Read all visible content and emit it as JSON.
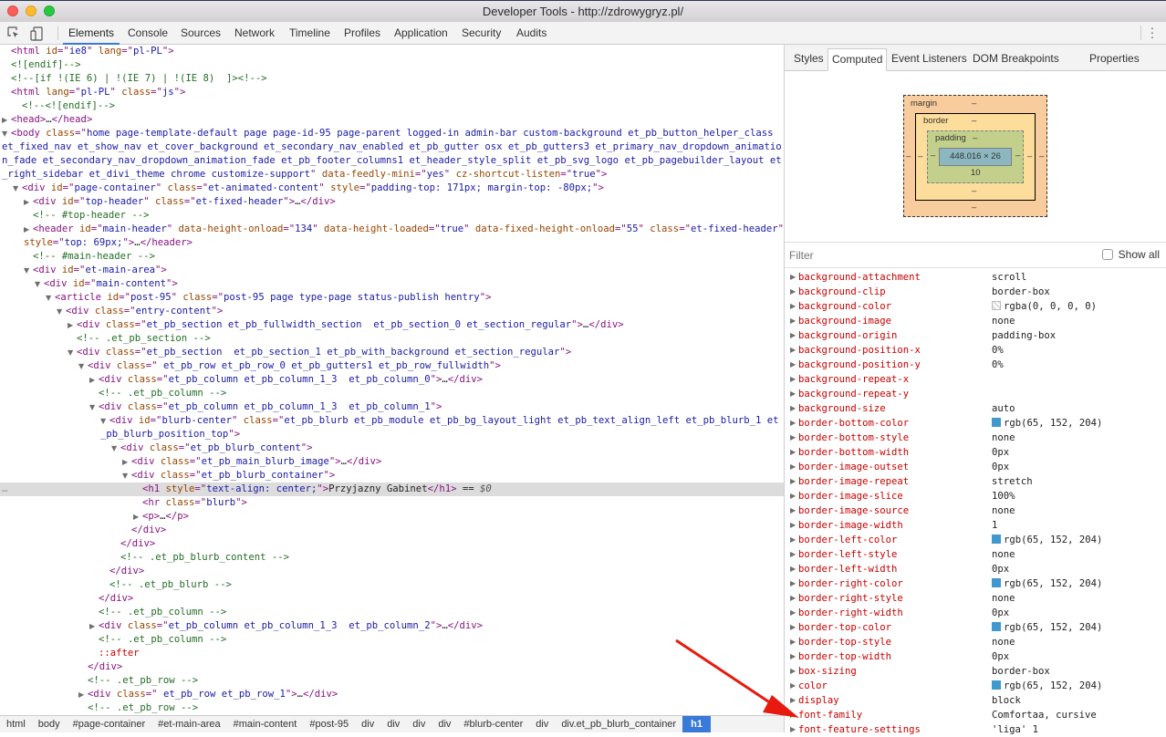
{
  "window": {
    "title": "Developer Tools - http://zdrowygryz.pl/"
  },
  "toolbar": {
    "inspect_icon": "inspect-element-icon",
    "device_icon": "device-toolbar-icon",
    "more_icon": "more-vertical-icon",
    "tabs": [
      {
        "label": "Elements",
        "active": true
      },
      {
        "label": "Console",
        "active": false
      },
      {
        "label": "Sources",
        "active": false
      },
      {
        "label": "Network",
        "active": false
      },
      {
        "label": "Timeline",
        "active": false
      },
      {
        "label": "Profiles",
        "active": false
      },
      {
        "label": "Application",
        "active": false
      },
      {
        "label": "Security",
        "active": false
      },
      {
        "label": "Audits",
        "active": false
      }
    ]
  },
  "elements": {
    "lines": [
      {
        "indent": 0,
        "tri": "",
        "html": "<span class=\"tag\">&lt;html</span> <span class=\"attr-n\">id</span><span class=\"tag\">=\"</span><span class=\"attr-v\">ie8</span><span class=\"tag\">\"</span> <span class=\"attr-n\">lang</span><span class=\"tag\">=\"</span><span class=\"attr-v\">pl-PL</span><span class=\"tag\">\"&gt;</span>"
      },
      {
        "indent": 0,
        "tri": "",
        "html": "<span class=\"comment\">&lt;![endif]--&gt;</span>"
      },
      {
        "indent": 0,
        "tri": "",
        "html": "<span class=\"comment\">&lt;!--[if !(IE 6) | !(IE 7) | !(IE 8)  ]&gt;&lt;!--&gt;</span>"
      },
      {
        "indent": 0,
        "tri": "",
        "html": "<span class=\"tag\">&lt;html</span> <span class=\"attr-n\">lang</span><span class=\"tag\">=\"</span><span class=\"attr-v\">pl-PL</span><span class=\"tag\">\"</span> <span class=\"attr-n\">class</span><span class=\"tag\">=\"</span><span class=\"attr-v\">js</span><span class=\"tag\">\"&gt;</span>"
      },
      {
        "indent": 1,
        "tri": "",
        "html": "<span class=\"comment\">&lt;!--&lt;![endif]--&gt;</span>"
      },
      {
        "indent": 0,
        "tri": "closed",
        "html": "<span class=\"tag\">&lt;head&gt;</span>…<span class=\"tag\">&lt;/head&gt;</span>"
      },
      {
        "indent": 0,
        "tri": "open",
        "wrap": true,
        "html": "<span class=\"tag\">&lt;body</span> <span class=\"attr-n\">class</span><span class=\"tag\">=\"</span><span class=\"attr-v\">home page-template-default page page-id-95 page-parent logged-in admin-bar custom-background et_pb_button_helper_class et_fixed_nav et_show_nav et_cover_background et_secondary_nav_enabled et_pb_gutter osx et_pb_gutters3 et_primary_nav_dropdown_animation_fade et_secondary_nav_dropdown_animation_fade et_pb_footer_columns1 et_header_style_split et_pb_svg_logo et_pb_pagebuilder_layout et_right_sidebar et_divi_theme chrome customize-support</span><span class=\"tag\">\"</span> <span class=\"attr-n\">data-feedly-mini</span><span class=\"tag\">=\"</span><span class=\"attr-v\">yes</span><span class=\"tag\">\"</span> <span class=\"attr-n\">cz-shortcut-listen</span><span class=\"tag\">=\"</span><span class=\"attr-v\">true</span><span class=\"tag\">\"&gt;</span>"
      },
      {
        "indent": 1,
        "tri": "open",
        "html": "<span class=\"tag\">&lt;div</span> <span class=\"attr-n\">id</span><span class=\"tag\">=\"</span><span class=\"attr-v\">page-container</span><span class=\"tag\">\"</span> <span class=\"attr-n\">class</span><span class=\"tag\">=\"</span><span class=\"attr-v\">et-animated-content</span><span class=\"tag\">\"</span> <span class=\"attr-n\">style</span><span class=\"tag\">=\"</span><span class=\"attr-v\">padding-top: 171px; margin-top: -80px;</span><span class=\"tag\">\"&gt;</span>"
      },
      {
        "indent": 2,
        "tri": "closed",
        "html": "<span class=\"tag\">&lt;div</span> <span class=\"attr-n\">id</span><span class=\"tag\">=\"</span><span class=\"attr-v\">top-header</span><span class=\"tag\">\"</span> <span class=\"attr-n\">class</span><span class=\"tag\">=\"</span><span class=\"attr-v\">et-fixed-header</span><span class=\"tag\">\"&gt;</span>…<span class=\"tag\">&lt;/div&gt;</span>"
      },
      {
        "indent": 2,
        "tri": "",
        "html": "<span class=\"comment\">&lt;!-- #top-header --&gt;</span>"
      },
      {
        "indent": 2,
        "tri": "closed",
        "wrap": true,
        "html": "<span class=\"tag\">&lt;header</span> <span class=\"attr-n\">id</span><span class=\"tag\">=\"</span><span class=\"attr-v\">main-header</span><span class=\"tag\">\"</span> <span class=\"attr-n\">data-height-onload</span><span class=\"tag\">=\"</span><span class=\"attr-v\">134</span><span class=\"tag\">\"</span> <span class=\"attr-n\">data-height-loaded</span><span class=\"tag\">=\"</span><span class=\"attr-v\">true</span><span class=\"tag\">\"</span> <span class=\"attr-n\">data-fixed-height-onload</span><span class=\"tag\">=\"</span><span class=\"attr-v\">55</span><span class=\"tag\">\"</span> <span class=\"attr-n\">class</span><span class=\"tag\">=\"</span><span class=\"attr-v\">et-fixed-header</span><span class=\"tag\">\"</span> <span class=\"attr-n\">style</span><span class=\"tag\">=\"</span><span class=\"attr-v\">top: 69px;</span><span class=\"tag\">\"&gt;</span>…<span class=\"tag\">&lt;/header&gt;</span>"
      },
      {
        "indent": 2,
        "tri": "",
        "html": "<span class=\"comment\">&lt;!-- #main-header --&gt;</span>"
      },
      {
        "indent": 2,
        "tri": "open",
        "html": "<span class=\"tag\">&lt;div</span> <span class=\"attr-n\">id</span><span class=\"tag\">=\"</span><span class=\"attr-v\">et-main-area</span><span class=\"tag\">\"&gt;</span>"
      },
      {
        "indent": 3,
        "tri": "open",
        "html": "<span class=\"tag\">&lt;div</span> <span class=\"attr-n\">id</span><span class=\"tag\">=\"</span><span class=\"attr-v\">main-content</span><span class=\"tag\">\"&gt;</span>"
      },
      {
        "indent": 4,
        "tri": "open",
        "html": "<span class=\"tag\">&lt;article</span> <span class=\"attr-n\">id</span><span class=\"tag\">=\"</span><span class=\"attr-v\">post-95</span><span class=\"tag\">\"</span> <span class=\"attr-n\">class</span><span class=\"tag\">=\"</span><span class=\"attr-v\">post-95 page type-page status-publish hentry</span><span class=\"tag\">\"&gt;</span>"
      },
      {
        "indent": 5,
        "tri": "open",
        "html": "<span class=\"tag\">&lt;div</span> <span class=\"attr-n\">class</span><span class=\"tag\">=\"</span><span class=\"attr-v\">entry-content</span><span class=\"tag\">\"&gt;</span>"
      },
      {
        "indent": 6,
        "tri": "closed",
        "html": "<span class=\"tag\">&lt;div</span> <span class=\"attr-n\">class</span><span class=\"tag\">=\"</span><span class=\"attr-v\">et_pb_section et_pb_fullwidth_section  et_pb_section_0 et_section_regular</span><span class=\"tag\">\"&gt;</span>…<span class=\"tag\">&lt;/div&gt;</span>"
      },
      {
        "indent": 6,
        "tri": "",
        "html": "<span class=\"comment\">&lt;!-- .et_pb_section --&gt;</span>"
      },
      {
        "indent": 6,
        "tri": "open",
        "html": "<span class=\"tag\">&lt;div</span> <span class=\"attr-n\">class</span><span class=\"tag\">=\"</span><span class=\"attr-v\">et_pb_section  et_pb_section_1 et_pb_with_background et_section_regular</span><span class=\"tag\">\"&gt;</span>"
      },
      {
        "indent": 7,
        "tri": "open",
        "html": "<span class=\"tag\">&lt;div</span> <span class=\"attr-n\">class</span><span class=\"tag\">=\"</span><span class=\"attr-v\"> et_pb_row et_pb_row_0 et_pb_gutters1 et_pb_row_fullwidth</span><span class=\"tag\">\"&gt;</span>"
      },
      {
        "indent": 8,
        "tri": "closed",
        "html": "<span class=\"tag\">&lt;div</span> <span class=\"attr-n\">class</span><span class=\"tag\">=\"</span><span class=\"attr-v\">et_pb_column et_pb_column_1_3  et_pb_column_0</span><span class=\"tag\">\"&gt;</span>…<span class=\"tag\">&lt;/div&gt;</span>"
      },
      {
        "indent": 8,
        "tri": "",
        "html": "<span class=\"comment\">&lt;!-- .et_pb_column --&gt;</span>"
      },
      {
        "indent": 8,
        "tri": "open",
        "html": "<span class=\"tag\">&lt;div</span> <span class=\"attr-n\">class</span><span class=\"tag\">=\"</span><span class=\"attr-v\">et_pb_column et_pb_column_1_3  et_pb_column_1</span><span class=\"tag\">\"&gt;</span>"
      },
      {
        "indent": 9,
        "tri": "open",
        "wrap": true,
        "html": "<span class=\"tag\">&lt;div</span> <span class=\"attr-n\">id</span><span class=\"tag\">=\"</span><span class=\"attr-v\">blurb-center</span><span class=\"tag\">\"</span> <span class=\"attr-n\">class</span><span class=\"tag\">=\"</span><span class=\"attr-v\">et_pb_blurb et_pb_module et_pb_bg_layout_light et_pb_text_align_left et_pb_blurb_1 et_pb_blurb_position_top</span><span class=\"tag\">\"&gt;</span>"
      },
      {
        "indent": 10,
        "tri": "open",
        "html": "<span class=\"tag\">&lt;div</span> <span class=\"attr-n\">class</span><span class=\"tag\">=\"</span><span class=\"attr-v\">et_pb_blurb_content</span><span class=\"tag\">\"&gt;</span>"
      },
      {
        "indent": 11,
        "tri": "closed",
        "html": "<span class=\"tag\">&lt;div</span> <span class=\"attr-n\">class</span><span class=\"tag\">=\"</span><span class=\"attr-v\">et_pb_main_blurb_image</span><span class=\"tag\">\"&gt;</span>…<span class=\"tag\">&lt;/div&gt;</span>"
      },
      {
        "indent": 11,
        "tri": "open",
        "html": "<span class=\"tag\">&lt;div</span> <span class=\"attr-n\">class</span><span class=\"tag\">=\"</span><span class=\"attr-v\">et_pb_blurb_container</span><span class=\"tag\">\"&gt;</span>"
      },
      {
        "indent": 12,
        "tri": "",
        "selected": true,
        "html": "<span class=\"tag\">&lt;h1</span> <span class=\"attr-n\">style</span><span class=\"tag\">=\"</span><span class=\"attr-v\">text-align: center;</span><span class=\"tag\">\"&gt;</span>Przyjazny Gabinet<span class=\"tag\">&lt;/h1&gt;</span> == <span class=\"dollar\">$0</span>"
      },
      {
        "indent": 12,
        "tri": "",
        "html": "<span class=\"tag\">&lt;hr</span> <span class=\"attr-n\">class</span><span class=\"tag\">=\"</span><span class=\"attr-v\">blurb</span><span class=\"tag\">\"&gt;</span>"
      },
      {
        "indent": 12,
        "tri": "closed",
        "html": "<span class=\"tag\">&lt;p&gt;</span>…<span class=\"tag\">&lt;/p&gt;</span>"
      },
      {
        "indent": 11,
        "tri": "",
        "html": "<span class=\"tag\">&lt;/div&gt;</span>"
      },
      {
        "indent": 10,
        "tri": "",
        "html": "<span class=\"tag\">&lt;/div&gt;</span>"
      },
      {
        "indent": 10,
        "tri": "",
        "html": "<span class=\"comment\">&lt;!-- .et_pb_blurb_content --&gt;</span>"
      },
      {
        "indent": 9,
        "tri": "",
        "html": "<span class=\"tag\">&lt;/div&gt;</span>"
      },
      {
        "indent": 9,
        "tri": "",
        "html": "<span class=\"comment\">&lt;!-- .et_pb_blurb --&gt;</span>"
      },
      {
        "indent": 8,
        "tri": "",
        "html": "<span class=\"tag\">&lt;/div&gt;</span>"
      },
      {
        "indent": 8,
        "tri": "",
        "html": "<span class=\"comment\">&lt;!-- .et_pb_column --&gt;</span>"
      },
      {
        "indent": 8,
        "tri": "closed",
        "html": "<span class=\"tag\">&lt;div</span> <span class=\"attr-n\">class</span><span class=\"tag\">=\"</span><span class=\"attr-v\">et_pb_column et_pb_column_1_3  et_pb_column_2</span><span class=\"tag\">\"&gt;</span>…<span class=\"tag\">&lt;/div&gt;</span>"
      },
      {
        "indent": 8,
        "tri": "",
        "html": "<span class=\"comment\">&lt;!-- .et_pb_column --&gt;</span>"
      },
      {
        "indent": 8,
        "tri": "",
        "html": "<span class=\"pseudo\">::after</span>"
      },
      {
        "indent": 7,
        "tri": "",
        "html": "<span class=\"tag\">&lt;/div&gt;</span>"
      },
      {
        "indent": 7,
        "tri": "",
        "html": "<span class=\"comment\">&lt;!-- .et_pb_row --&gt;</span>"
      },
      {
        "indent": 7,
        "tri": "closed",
        "html": "<span class=\"tag\">&lt;div</span> <span class=\"attr-n\">class</span><span class=\"tag\">=\"</span><span class=\"attr-v\"> et_pb_row et_pb_row_1</span><span class=\"tag\">\"&gt;</span>…<span class=\"tag\">&lt;/div&gt;</span>"
      },
      {
        "indent": 7,
        "tri": "",
        "html": "<span class=\"comment\">&lt;!-- .et_pb_row --&gt;</span>"
      }
    ]
  },
  "breadcrumbs": [
    {
      "label": "html",
      "active": false
    },
    {
      "label": "body",
      "active": false
    },
    {
      "label": "#page-container",
      "active": false
    },
    {
      "label": "#et-main-area",
      "active": false
    },
    {
      "label": "#main-content",
      "active": false
    },
    {
      "label": "#post-95",
      "active": false
    },
    {
      "label": "div",
      "active": false
    },
    {
      "label": "div",
      "active": false
    },
    {
      "label": "div",
      "active": false
    },
    {
      "label": "div",
      "active": false
    },
    {
      "label": "#blurb-center",
      "active": false
    },
    {
      "label": "div",
      "active": false
    },
    {
      "label": "div.et_pb_blurb_container",
      "active": false
    },
    {
      "label": "h1",
      "active": true
    }
  ],
  "sidebar": {
    "tabs": [
      {
        "label": "Styles",
        "active": false
      },
      {
        "label": "Computed",
        "active": true
      },
      {
        "label": "Event Listeners",
        "active": false
      },
      {
        "label": "DOM Breakpoints",
        "active": false
      },
      {
        "label": "Properties",
        "active": false
      }
    ],
    "box_model": {
      "margin_label": "margin",
      "border_label": "border",
      "padding_label": "padding",
      "content_size": "448.016 × 26",
      "margin": {
        "top": "–",
        "right": "–",
        "bottom": "–",
        "left": "–"
      },
      "border": {
        "top": "–",
        "right": "–",
        "bottom": "–",
        "left": "–"
      },
      "padding": {
        "top": "–",
        "right": "–",
        "bottom": "10",
        "left": "–"
      }
    },
    "filter": {
      "placeholder": "Filter",
      "value": ""
    },
    "show_all": {
      "label": "Show all",
      "checked": false
    },
    "properties": [
      {
        "name": "background-attachment",
        "value": "scroll"
      },
      {
        "name": "background-clip",
        "value": "border-box"
      },
      {
        "name": "background-color",
        "value": "rgba(0, 0, 0, 0)",
        "swatch": "transparent"
      },
      {
        "name": "background-image",
        "value": "none"
      },
      {
        "name": "background-origin",
        "value": "padding-box"
      },
      {
        "name": "background-position-x",
        "value": "0%"
      },
      {
        "name": "background-position-y",
        "value": "0%"
      },
      {
        "name": "background-repeat-x",
        "value": ""
      },
      {
        "name": "background-repeat-y",
        "value": ""
      },
      {
        "name": "background-size",
        "value": "auto"
      },
      {
        "name": "border-bottom-color",
        "value": "rgb(65, 152, 204)",
        "swatch": "#4198cc"
      },
      {
        "name": "border-bottom-style",
        "value": "none"
      },
      {
        "name": "border-bottom-width",
        "value": "0px"
      },
      {
        "name": "border-image-outset",
        "value": "0px"
      },
      {
        "name": "border-image-repeat",
        "value": "stretch"
      },
      {
        "name": "border-image-slice",
        "value": "100%"
      },
      {
        "name": "border-image-source",
        "value": "none"
      },
      {
        "name": "border-image-width",
        "value": "1"
      },
      {
        "name": "border-left-color",
        "value": "rgb(65, 152, 204)",
        "swatch": "#4198cc"
      },
      {
        "name": "border-left-style",
        "value": "none"
      },
      {
        "name": "border-left-width",
        "value": "0px"
      },
      {
        "name": "border-right-color",
        "value": "rgb(65, 152, 204)",
        "swatch": "#4198cc"
      },
      {
        "name": "border-right-style",
        "value": "none"
      },
      {
        "name": "border-right-width",
        "value": "0px"
      },
      {
        "name": "border-top-color",
        "value": "rgb(65, 152, 204)",
        "swatch": "#4198cc"
      },
      {
        "name": "border-top-style",
        "value": "none"
      },
      {
        "name": "border-top-width",
        "value": "0px"
      },
      {
        "name": "box-sizing",
        "value": "border-box"
      },
      {
        "name": "color",
        "value": "rgb(65, 152, 204)",
        "swatch": "#4198cc"
      },
      {
        "name": "display",
        "value": "block"
      },
      {
        "name": "font-family",
        "value": "Comfortaa, cursive"
      },
      {
        "name": "font-feature-settings",
        "value": "'liga' 1"
      }
    ]
  },
  "annotation": {
    "arrow_color": "#e8190f",
    "points_to": "font-family"
  },
  "colors": {
    "accent": "#3879d9",
    "tag": "#881280",
    "attr_name": "#994500",
    "attr_value": "#1a1aa6",
    "comment": "#236e25",
    "prop_name": "#c80000"
  }
}
